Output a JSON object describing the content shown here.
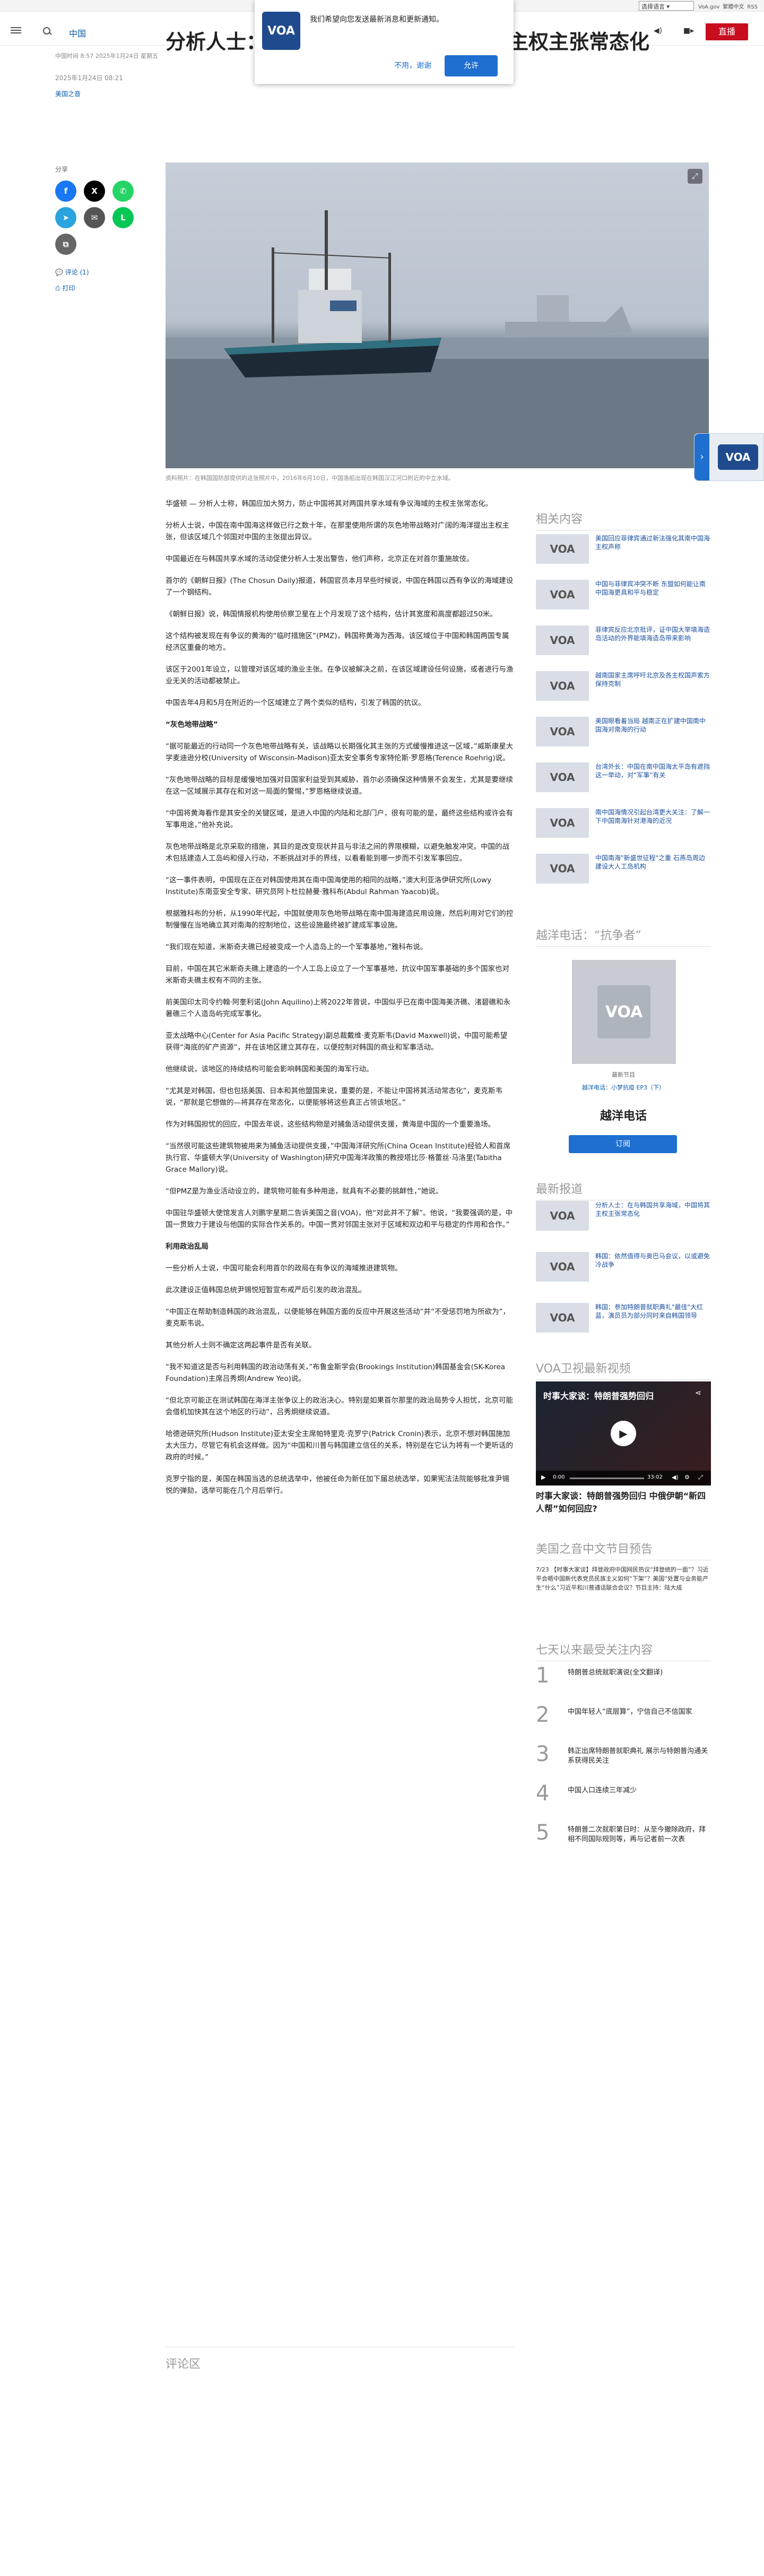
{
  "topbar": {
    "language_select": "选择语言",
    "links": [
      "VoA.gov",
      "繁體中文",
      "RSS"
    ]
  },
  "header": {
    "nav_link": "中国",
    "live_label": "直播"
  },
  "popup": {
    "logo": "VOA",
    "message": "我们希望向您发送最新消息和更新通知。",
    "decline": "不用，谢谢",
    "allow": "允许"
  },
  "article": {
    "meta_line": "中国时间 8:57 2025年1月24日 星期五",
    "date": "2025年1月24日 08:21",
    "author": "美国之音",
    "title": "分析人士：在与韩国共享海域，中国将主权主张常态化",
    "share_label": "分享",
    "comments_link": "评论 (1)",
    "print_link": "打印",
    "photo_caption": "资料照片：在韩国国防部提供的这张照片中，2016年6月10日，中国渔船出现在韩国汉江河口附近的中立水域。",
    "paragraphs": [
      {
        "text": "华盛顿 — 分析人士称，韩国应加大努力，防止中国将其对两国共享水域有争议海域的主权主张常态化。",
        "bold": false
      },
      {
        "text": "分析人士说，中国在南中国海这样做已行之数十年，在那里使用所谓的灰色地带战略对广阔的海洋提出主权主张，但该区域几个邻国对中国的主张提出异议。",
        "bold": false
      },
      {
        "text": "中国最近在与韩国共享水域的活动促使分析人士发出警告，他们声称，北京正在对首尔重施故伎。",
        "bold": false
      },
      {
        "text": "首尔的《朝鲜日报》(The Chosun Daily)报道，韩国官员本月早些时候说，中国在韩国以西有争议的海域建设了一个钢结构。",
        "bold": false
      },
      {
        "text": "《朝鲜日报》说，韩国情报机构使用侦察卫星在上个月发现了这个结构，估计其宽度和高度都超过50米。",
        "bold": false
      },
      {
        "text": "这个结构被发现在有争议的黄海的“临时措施区”(PMZ)，韩国称黄海为西海。该区域位于中国和韩国两国专属经济区重叠的地方。",
        "bold": false
      },
      {
        "text": "该区于2001年设立，以管理对该区域的渔业主张。在争议被解决之前，在该区域建设任何设施，或者进行与渔业无关的活动都被禁止。",
        "bold": false
      },
      {
        "text": "中国去年4月和5月在附近的一个区域建立了两个类似的结构，引发了韩国的抗议。",
        "bold": false
      },
      {
        "text": "“灰色地带战略”",
        "bold": true
      },
      {
        "text": "“据可能最近的行动同一个灰色地带战略有关，该战略以长期强化其主张的方式缓慢推进这一区域，”威斯康星大学麦迪逊分校(University of Wisconsin-Madison)亚太安全事务专家特伦斯·罗恩格(Terence Roehrig)说。",
        "bold": false
      },
      {
        "text": "“灰色地带战略的目标是缓慢地加强对目国家利益受到其威胁，首尔必须确保这种情景不会发生，尤其是要继续在这一区域展示其存在和对这一局面的警惕，”罗恩格继续说道。",
        "bold": false
      },
      {
        "text": "“中国将黄海看作是其安全的关键区域，是进入中国的内陆和北部门户，很有可能的是，最终这些结构或许会有军事用途，”他补充说。",
        "bold": false
      },
      {
        "text": "灰色地带战略是北京采取的措施，其目的是改变现状并且与非法之间的界限模糊，以避免触发冲突。中国的战术包括建造人工岛屿和侵入行动，不断挑战对手的界线，以看看能到哪一步而不引发军事回应。",
        "bold": false
      },
      {
        "text": "“这一事件表明，中国现在正在对韩国使用其在南中国海使用的相同的战略，”澳大利亚洛伊研究所(Lowy Institute)东南亚安全专家、研究员阿卜杜拉赫曼·雅科布(Abdul Rahman Yaacob)说。",
        "bold": false
      },
      {
        "text": "根据雅科布的分析，从1990年代起，中国就使用灰色地带战略在南中国海建造民用设施，然后利用对它们的控制慢慢在当地确立其对南海的控制地位，这些设施最终被扩建成军事设施。",
        "bold": false
      },
      {
        "text": "“我们现在知道，米斯奇夫礁已经被变成一个人造岛上的一个军事基地，”雅科布说。",
        "bold": false
      },
      {
        "text": "目前，中国在其它米斯奇夫礁上建造的一个人工岛上设立了一个军事基地，抗议中国军事基础的多个国家也对米斯奇夫礁主权有不同的主张。",
        "bold": false
      },
      {
        "text": "前美国印太司令约翰·阿奎利诺(John Aquilino)上将2022年曾说，中国似乎已在南中国海美济礁、渚碧礁和永暑礁三个人造岛屿完成军事化。",
        "bold": false
      },
      {
        "text": "亚太战略中心(Center for Asia Pacific Strategy)副总裁戴维·麦克斯韦(David Maxwell)说，中国可能希望获得“海底的矿产资源”，并在该地区建立其存在，以便控制对韩国的商业和军事活动。",
        "bold": false
      },
      {
        "text": "他继续说，该地区的持续结构可能会影响韩国和美国的海军行动。",
        "bold": false
      },
      {
        "text": "“尤其是对韩国，但也包括美国、日本和其他盟国来说，重要的是，不能让中国将其活动常态化”，麦克斯韦说，“那就是它想做的—将其存在常态化，以便能够将这些真正占领该地区。”",
        "bold": false
      },
      {
        "text": "作为对韩国担忧的回应，中国去年说，这些结构物是对捕鱼活动提供支援，黄海是中国的一个重要渔场。",
        "bold": false
      },
      {
        "text": "“当然很可能这些建筑物被用来为捕鱼活动提供支援，”中国海洋研究所(China Ocean Institute)经验人和首席执行官、华盛顿大学(University of Washington)研究中国海洋政策的教授塔比莎·格蕾丝·马洛里(Tabitha Grace Mallory)说。",
        "bold": false
      },
      {
        "text": "“但PMZ是为渔业活动设立的，建筑物可能有多种用途，就具有不必要的挑衅性，”她说。",
        "bold": false
      },
      {
        "text": "中国驻华盛顿大使馆发言人刘鹏宇星期二告诉美国之音(VOA)，他“对此并不了解”。他说，“我要强调的是，中国一贯致力于建设与他国的实际合作关系的。中国一贯对邻国主张对于区域和双边和平与稳定的作用和合作。”",
        "bold": false
      },
      {
        "text": "利用政治乱局",
        "bold": true
      },
      {
        "text": "一些分析人士说，中国可能会利用首尔的政局在有争议的海域推进建筑物。",
        "bold": false
      },
      {
        "text": "此次建设正值韩国总统尹锡悦短暂宣布戒严后引发的政治混乱。",
        "bold": false
      },
      {
        "text": "“中国正在帮助制造韩国的政治混乱，以便能够在韩国方面的反应中开展这些活动”并“不受惩罚地为所欲为”，麦克斯韦说。",
        "bold": false
      },
      {
        "text": "其他分析人士则不确定这两起事件是否有关联。",
        "bold": false
      },
      {
        "text": "“我不知道这是否与利用韩国的政治动荡有关，”布鲁金斯学会(Brookings Institution)韩国基金会(SK-Korea Foundation)主席吕秀炯(Andrew Yeo)说。",
        "bold": false
      },
      {
        "text": "“但北京可能正在测试韩国在海洋主张争议上的政治决心。特别是如果首尔那里的政治局势令人担忧，北京可能会借机加快其在这个地区的行动”，吕秀炯继续说道。",
        "bold": false
      },
      {
        "text": "哈德逊研究所(Hudson Institute)亚太安全主席帕特里克·克罗宁(Patrick Cronin)表示，北京不想对韩国施加太大压力，尽管它有机会这样做。因为“中国和川普与韩国建立信任的关系，特别是在它认为将有一个更听话的政府的时候。”",
        "bold": false
      },
      {
        "text": "克罗宁指的是，美国在韩国当选的总统选举中，他被任命为新任加下届总统选举，如果宪法法院能够批准尹锡悦的弹劾，选举可能在几个月后举行。",
        "bold": false
      }
    ],
    "comments_section": "评论区"
  },
  "sidebar": {
    "related_title": "相关内容",
    "related": [
      {
        "logo": "VOA",
        "title": "美国回应菲律宾通过新法强化其南中国海主权声称"
      },
      {
        "logo": "VOA",
        "title": "中国与菲律宾冲突不断 东盟如何能让南中国海更具和平与稳定"
      },
      {
        "logo": "VOA",
        "title": "菲律宾反应北京批评，证中国大举填海造岛活动的外界能填海造岛带来影响"
      },
      {
        "logo": "VOA",
        "title": "越南国家主席呼吁北京及各主权国声索方保持克制"
      },
      {
        "logo": "VOA",
        "title": "美国眼看着当局 越南正在扩建中国南中国海对南海的行动"
      },
      {
        "logo": "VOA",
        "title": "台湾外长：中国在南中国海太平岛有遮挡这一举动，对“军事”有关"
      },
      {
        "logo": "VOA",
        "title": "南中国海情况引起台湾更大关注：了解一下中国南海针对港海的近况"
      },
      {
        "logo": "VOA",
        "title": "中国南海\"新盛世征程\"之重 石燕岛周边建设大人工岛机构"
      }
    ],
    "program_title": "越洋电话：“抗争者”",
    "program_logo": "VOA",
    "program_label": "最新节目",
    "program_meta": "越洋电话：小梦抗疫 EP3（下）",
    "program_name": "越洋电话",
    "subscribe": "订阅",
    "latest_title": "最新报道",
    "latest": [
      {
        "logo": "VOA",
        "title": "分析人士：在与韩国共享海域，中国将其主权主张常态化"
      },
      {
        "logo": "VOA",
        "title": "韩国：依然值得与奥巴马会议，以或避免冷战争"
      },
      {
        "logo": "VOA",
        "title": "韩国：参加特朗普就职典礼\"最佳\"大红蓝，演员员为部分同时来自韩国领导"
      }
    ],
    "video_section": "VOA卫视最新视频",
    "video_title": "时事大家谈：特朗普强势回归",
    "video_time": "0:00",
    "video_duration": "33:02",
    "video_caption": "时事大家谈：特朗普强势回归 中俄伊朝“新四人帮”如何回应?",
    "preview_title": "美国之音中文节目预告",
    "preview_text": "7/23 【时事大家谈】拜登政府中国网民热议“拜登统的一面”？习近平会晤中国新代表党员民族主义如何“下架”？美国“处置与业务能产生“什么”习近平和川普通话联合会议？节目主持：陆大成",
    "rank_title": "七天以来最受关注内容",
    "rank": [
      {
        "n": "1",
        "title": "特朗普总统就职演说(全文翻译)"
      },
      {
        "n": "2",
        "title": "中国年轻人“底层算”，宁信自己不信国家"
      },
      {
        "n": "3",
        "title": "韩正出席特朗普就职典礼 展示与特朗普沟通关系获得民关注"
      },
      {
        "n": "4",
        "title": "中国人口连续三年减少"
      },
      {
        "n": "5",
        "title": "特朗普二次就职第日时：从至今撤除政府，拜相不同国际规则等，再与记者前一次表"
      }
    ]
  }
}
